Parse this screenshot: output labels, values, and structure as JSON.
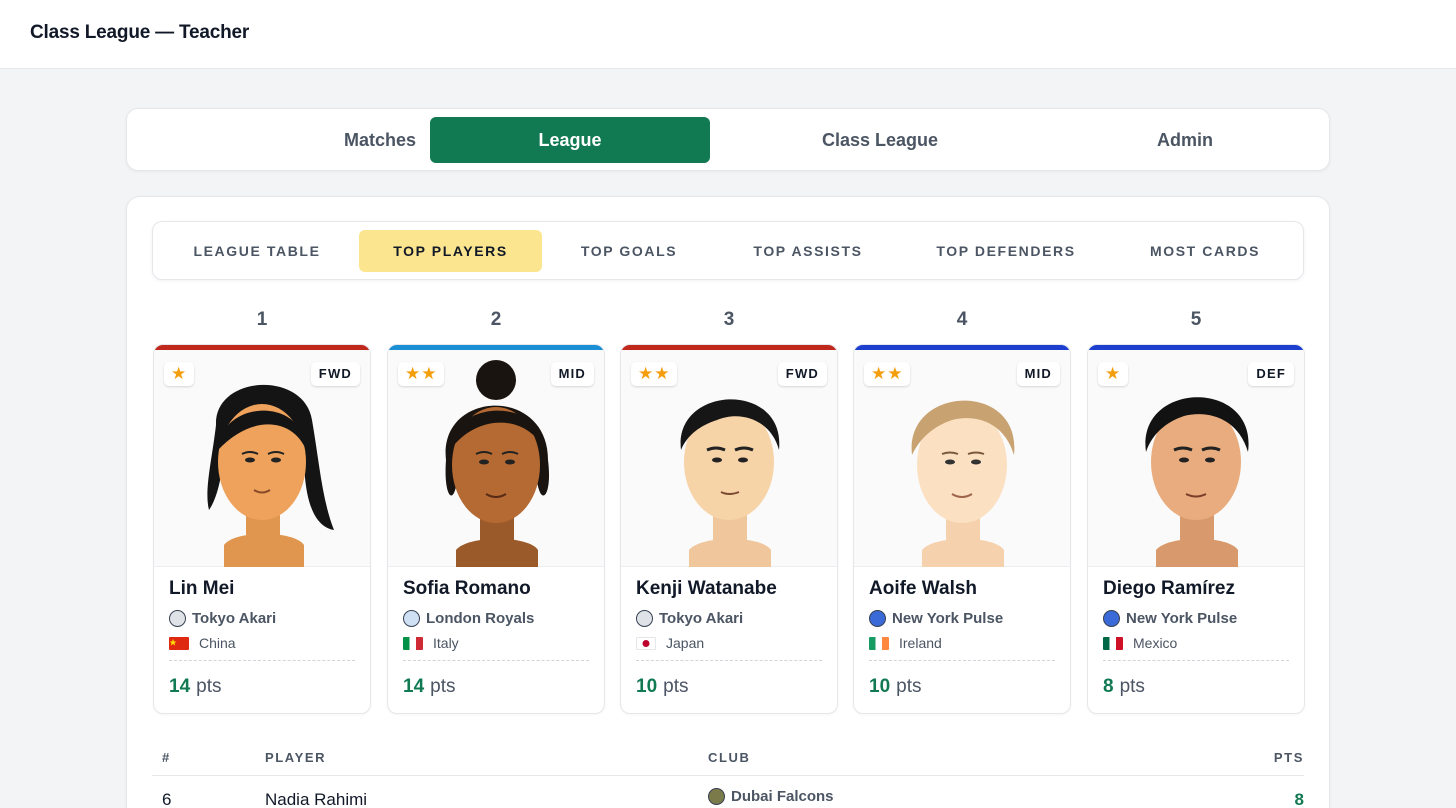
{
  "app": {
    "title": "Class League — Teacher"
  },
  "main_nav": {
    "tabs": [
      {
        "label": "Matches",
        "active": false
      },
      {
        "label": "League",
        "active": true
      },
      {
        "label": "Class League",
        "active": false
      },
      {
        "label": "Admin",
        "active": false
      }
    ]
  },
  "sub_nav": {
    "tabs": [
      {
        "label": "LEAGUE TABLE",
        "active": false
      },
      {
        "label": "TOP PLAYERS",
        "active": true
      },
      {
        "label": "TOP GOALS",
        "active": false
      },
      {
        "label": "TOP ASSISTS",
        "active": false
      },
      {
        "label": "TOP DEFENDERS",
        "active": false
      },
      {
        "label": "MOST CARDS",
        "active": false
      }
    ]
  },
  "top_players": [
    {
      "rank": "1",
      "stars": "★",
      "position": "FWD",
      "name": "Lin Mei",
      "club": "Tokyo Akari",
      "country": "China",
      "points": "14",
      "points_unit": "pts",
      "accent_color": "#c0271d"
    },
    {
      "rank": "2",
      "stars": "★★",
      "position": "MID",
      "name": "Sofia Romano",
      "club": "London Royals",
      "country": "Italy",
      "points": "14",
      "points_unit": "pts",
      "accent_color": "#1a8fd6"
    },
    {
      "rank": "3",
      "stars": "★★",
      "position": "FWD",
      "name": "Kenji Watanabe",
      "club": "Tokyo Akari",
      "country": "Japan",
      "points": "10",
      "points_unit": "pts",
      "accent_color": "#c0271d"
    },
    {
      "rank": "4",
      "stars": "★★",
      "position": "MID",
      "name": "Aoife Walsh",
      "club": "New York Pulse",
      "country": "Ireland",
      "points": "10",
      "points_unit": "pts",
      "accent_color": "#1c3fd0"
    },
    {
      "rank": "5",
      "stars": "★",
      "position": "DEF",
      "name": "Diego Ramírez",
      "club": "New York Pulse",
      "country": "Mexico",
      "points": "8",
      "points_unit": "pts",
      "accent_color": "#1c3fd0"
    }
  ],
  "table": {
    "headers": {
      "rank": "#",
      "player": "PLAYER",
      "club": "CLUB",
      "points": "PTS"
    },
    "rows": [
      {
        "rank": "6",
        "player": "Nadia Rahimi",
        "club": "Dubai Falcons",
        "points": "8"
      }
    ]
  },
  "colors": {
    "brand": "#127a52",
    "active_subtab": "#fbe58f",
    "star": "#f59e0b"
  }
}
